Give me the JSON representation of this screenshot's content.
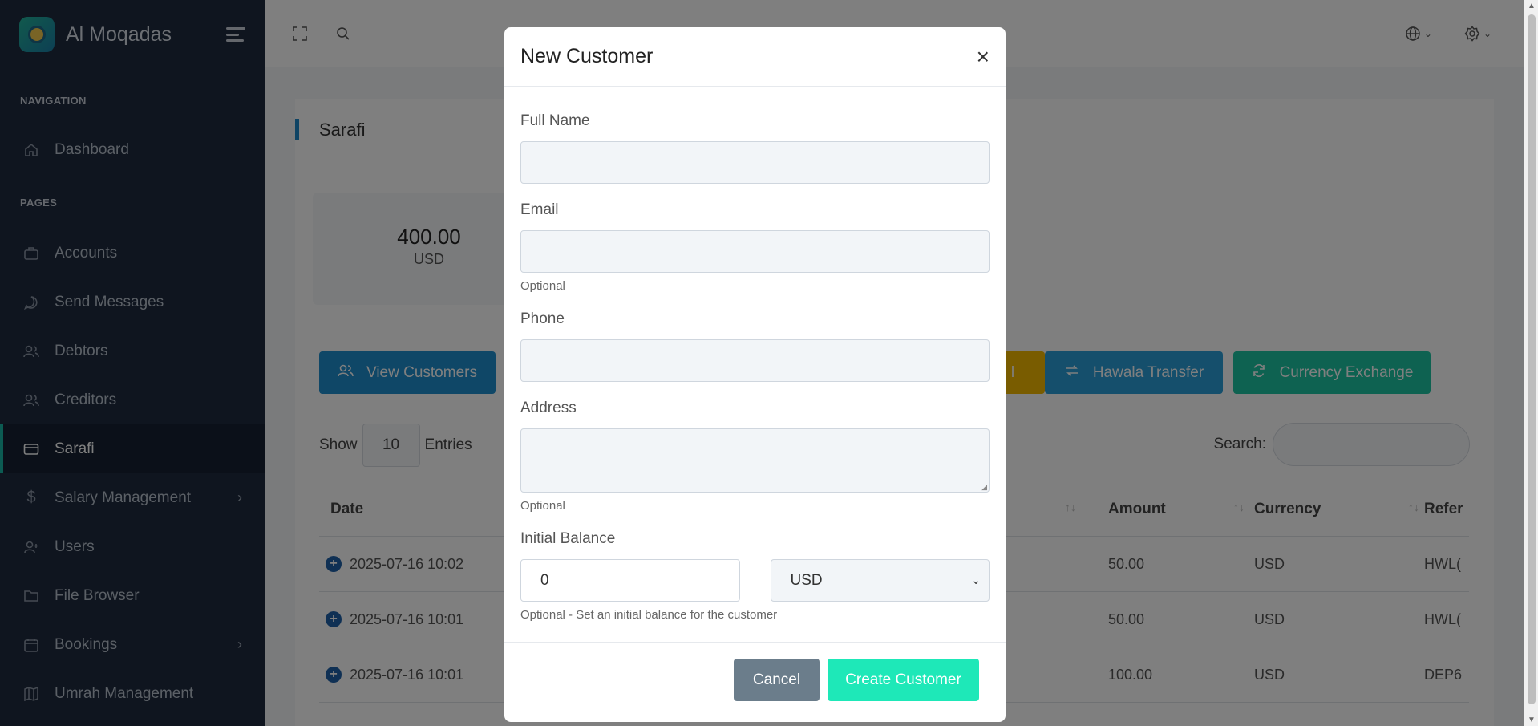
{
  "brand": {
    "name": "Al Moqadas"
  },
  "sidebar": {
    "section_navigation": "NAVIGATION",
    "section_pages": "PAGES",
    "dashboard": "Dashboard",
    "items": [
      {
        "label": "Accounts"
      },
      {
        "label": "Send Messages"
      },
      {
        "label": "Debtors"
      },
      {
        "label": "Creditors"
      },
      {
        "label": "Sarafi"
      },
      {
        "label": "Salary Management"
      },
      {
        "label": "Users"
      },
      {
        "label": "File Browser"
      },
      {
        "label": "Bookings"
      },
      {
        "label": "Umrah Management"
      }
    ]
  },
  "page": {
    "title": "Sarafi",
    "balance": {
      "amount": "400.00",
      "currency": "USD"
    },
    "buttons": {
      "view_customers": "View Customers",
      "yellow_partial": "l",
      "hawala_transfer": "Hawala Transfer",
      "currency_exchange": "Currency Exchange"
    },
    "show_label": "Show",
    "entries_value": "10",
    "entries_label": "Entries",
    "search_label": "Search:",
    "table": {
      "headers": {
        "date": "Date",
        "amount": "Amount",
        "currency": "Currency",
        "reference": "Refer"
      },
      "rows": [
        {
          "date": "2025-07-16 10:02",
          "amount": "50.00",
          "currency": "USD",
          "reference": "HWL("
        },
        {
          "date": "2025-07-16 10:01",
          "amount": "50.00",
          "currency": "USD",
          "reference": "HWL("
        },
        {
          "date": "2025-07-16 10:01",
          "amount": "100.00",
          "currency": "USD",
          "reference": "DEP6"
        }
      ]
    }
  },
  "modal": {
    "title": "New Customer",
    "close_symbol": "×",
    "full_name_label": "Full Name",
    "email_label": "Email",
    "email_hint": "Optional",
    "phone_label": "Phone",
    "address_label": "Address",
    "address_hint": "Optional",
    "initial_balance_label": "Initial Balance",
    "initial_balance_value": "0",
    "currency_value": "USD",
    "initial_balance_hint": "Optional - Set an initial balance for the customer",
    "cancel": "Cancel",
    "create": "Create Customer"
  },
  "colors": {
    "sidebar_bg": "#1e2a3e",
    "accent_teal": "#19b6a4",
    "primary_blue": "#1e8fcf",
    "create_btn": "#1ee8b8",
    "cancel_btn": "#6b7d8b"
  }
}
